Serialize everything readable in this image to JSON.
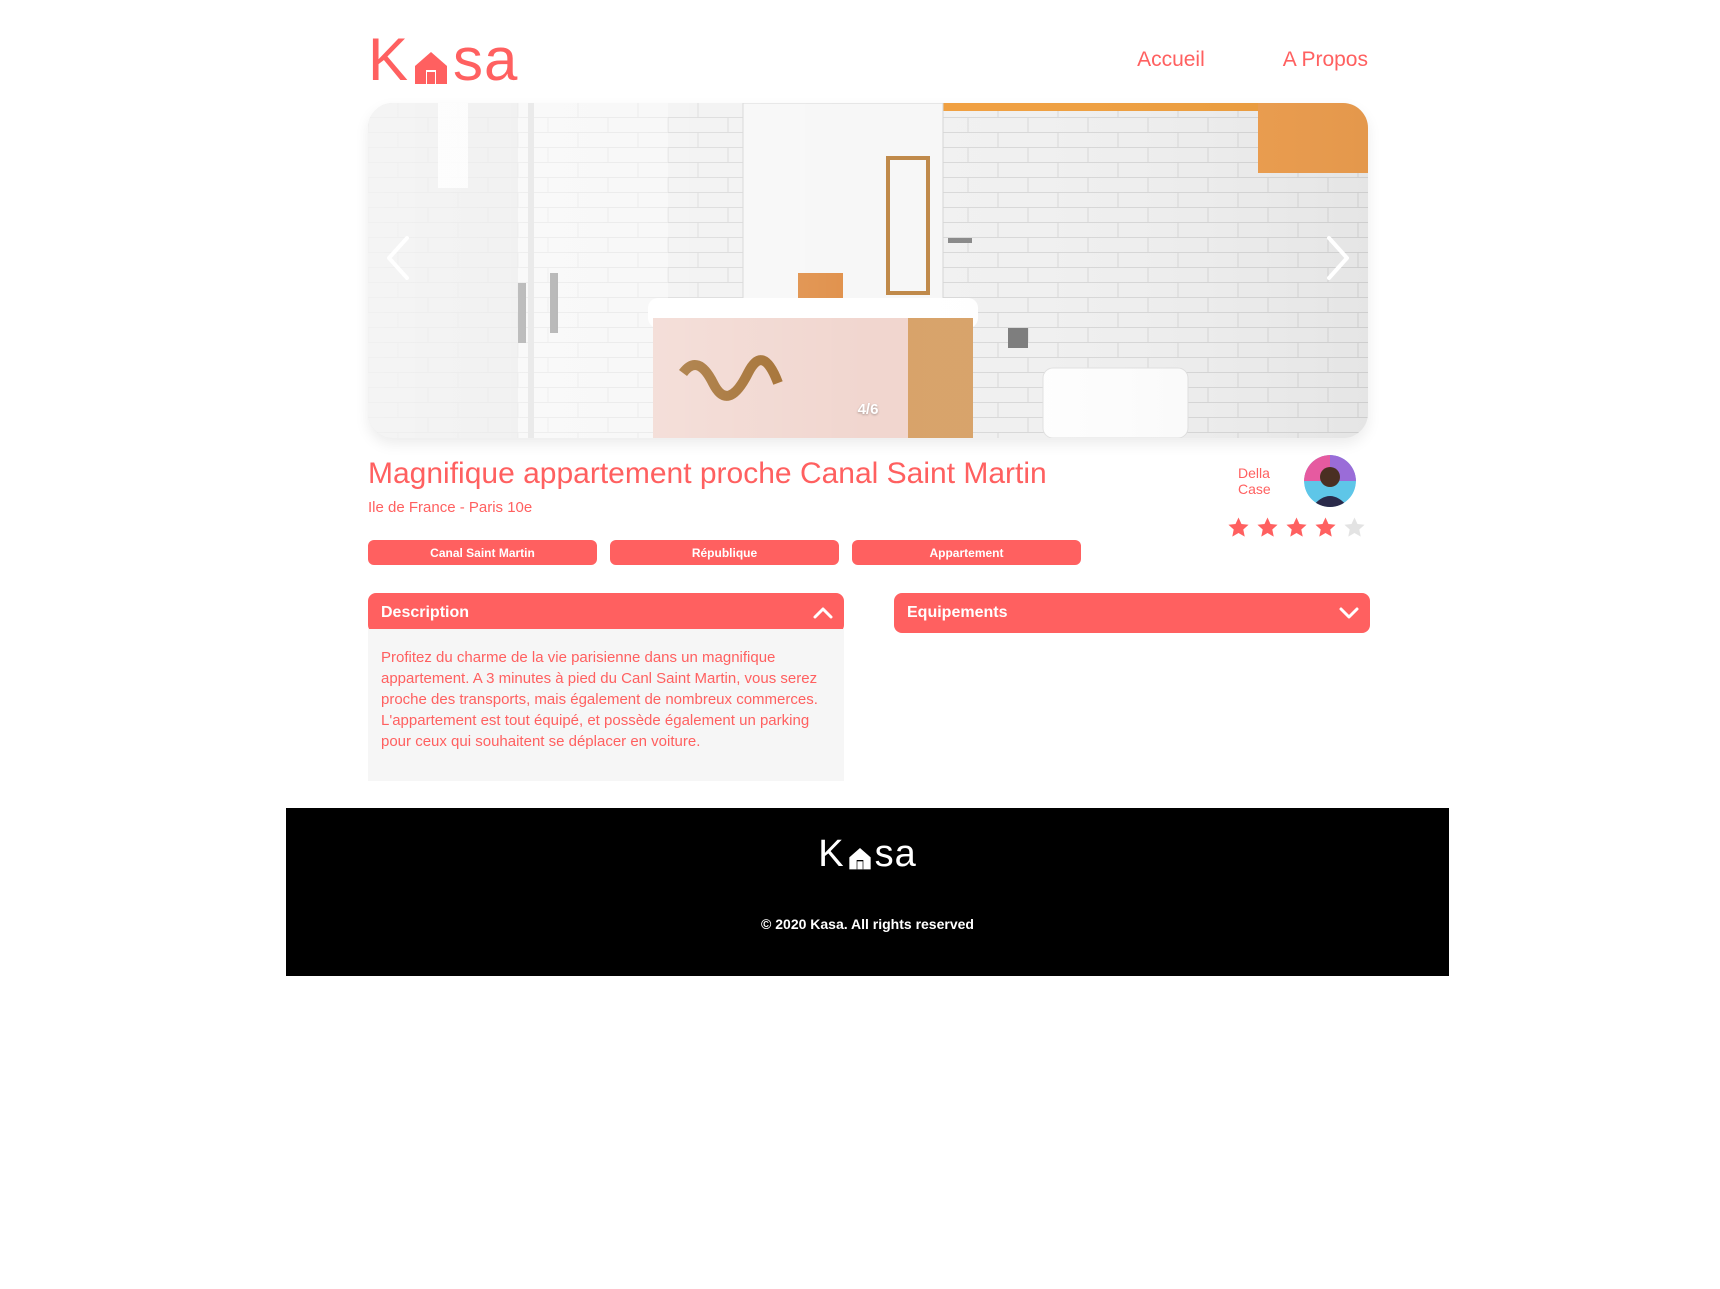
{
  "brand_color": "#FF6060",
  "header": {
    "logo": {
      "left": "K",
      "right": "sa",
      "icon": "house-icon"
    },
    "nav": [
      {
        "label": "Accueil"
      },
      {
        "label": "A Propos"
      }
    ]
  },
  "carousel": {
    "counter": "4/6",
    "prev_icon": "chevron-left-icon",
    "next_icon": "chevron-right-icon"
  },
  "listing": {
    "title": "Magnifique appartement proche Canal Saint Martin",
    "location": "Ile de France - Paris 10e",
    "tags": [
      "Canal Saint Martin",
      "République",
      "Appartement"
    ],
    "host": {
      "first_name": "Della",
      "last_name": "Case"
    },
    "rating": 4,
    "rating_max": 5
  },
  "collapses": {
    "description": {
      "title": "Description",
      "icon": "chevron-up-icon",
      "text": "Profitez du charme de la vie parisienne dans un magnifique appartement. A 3 minutes à pied du Canl Saint Martin, vous serez proche des transports, mais également de nombreux commerces. L'appartement est tout équipé, et possède également un parking pour ceux qui souhaitent se déplacer en voiture."
    },
    "equipments": {
      "title": "Equipements",
      "icon": "chevron-down-icon"
    }
  },
  "footer": {
    "logo": {
      "left": "K",
      "right": "sa"
    },
    "copyright": "© 2020 Kasa. All rights reserved"
  }
}
